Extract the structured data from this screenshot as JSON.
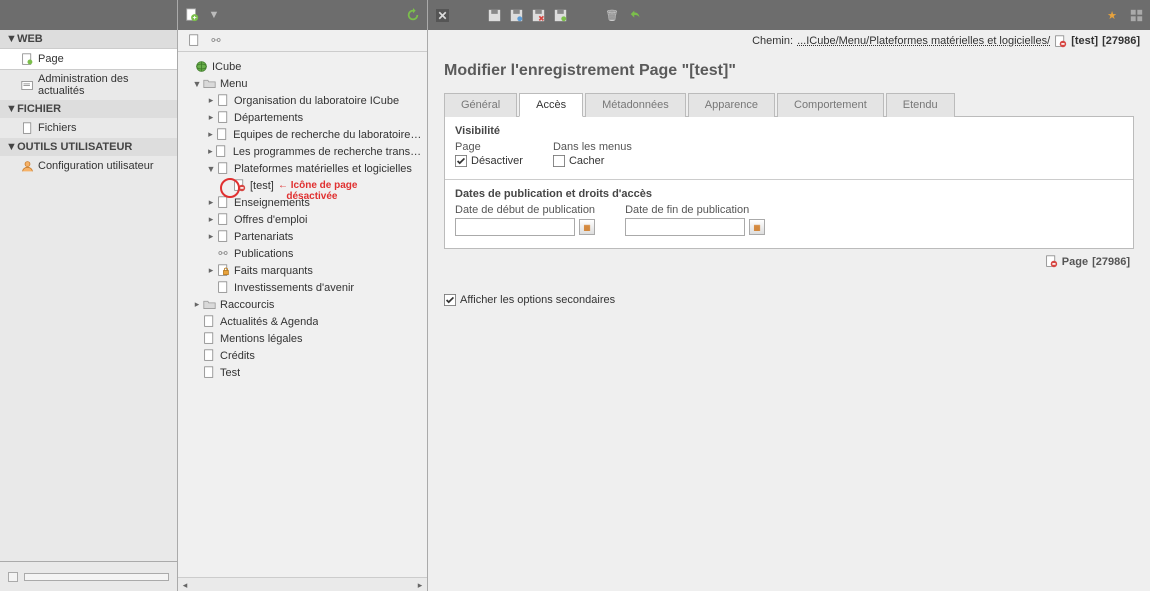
{
  "nav": {
    "sections": [
      {
        "title": "WEB",
        "items": [
          {
            "label": "Page",
            "icon": "page",
            "selected": true
          },
          {
            "label": "Administration des actualités",
            "icon": "news"
          }
        ]
      },
      {
        "title": "FICHIER",
        "items": [
          {
            "label": "Fichiers",
            "icon": "file"
          }
        ]
      },
      {
        "title": "OUTILS UTILISATEUR",
        "items": [
          {
            "label": "Configuration utilisateur",
            "icon": "user"
          }
        ]
      }
    ]
  },
  "tree": {
    "root": {
      "label": "ICube",
      "icon": "globe"
    },
    "menu": {
      "label": "Menu"
    },
    "items_menu": [
      "Organisation du laboratoire ICube",
      "Départements",
      "Equipes de recherche du laboratoire ICube",
      "Les programmes de recherche transversaux",
      "Plateformes matérielles et logicielles"
    ],
    "test_label": "[test]",
    "items_after": [
      "Enseignements",
      "Offres d'emploi",
      "Partenariats"
    ],
    "publications": "Publications",
    "faits": "Faits marquants",
    "invest": "Investissements d'avenir",
    "raccourcis": "Raccourcis",
    "bottom": [
      "Actualités & Agenda",
      "Mentions légales",
      "Crédits",
      "Test"
    ],
    "annotation_line1": "Icône de page",
    "annotation_line2": "désactivée"
  },
  "path": {
    "label": "Chemin:",
    "link": "...ICube/Menu/Plateformes matérielles et logicielles/",
    "page": "[test]",
    "id": "[27986]"
  },
  "title": "Modifier l'enregistrement Page \"[test]\"",
  "tabs": [
    "Général",
    "Accès",
    "Métadonnées",
    "Apparence",
    "Comportement",
    "Etendu"
  ],
  "active_tab": 1,
  "visibility": {
    "legend": "Visibilité",
    "page_label": "Page",
    "menu_label": "Dans les menus",
    "disable_label": "Désactiver",
    "hide_label": "Cacher",
    "disable_checked": true,
    "hide_checked": false
  },
  "publication": {
    "legend": "Dates de publication et droits d'accès",
    "start_label": "Date de début de publication",
    "end_label": "Date de fin de publication",
    "start_value": "",
    "end_value": ""
  },
  "footer": {
    "label": "Page",
    "id": "[27986]"
  },
  "secondary_label": "Afficher les options secondaires",
  "secondary_checked": true
}
